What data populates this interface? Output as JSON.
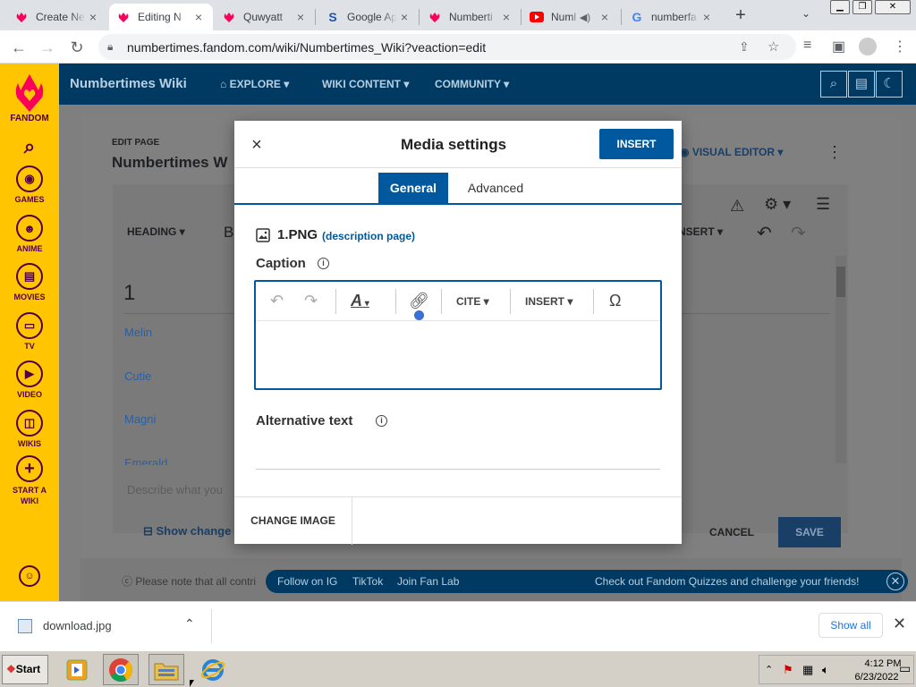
{
  "browser": {
    "tabs": [
      {
        "title": "Create Ne",
        "icon": "fandom-icon"
      },
      {
        "title": "Editing N",
        "icon": "fandom-icon",
        "active": true
      },
      {
        "title": "Quwyatt",
        "icon": "fandom-icon"
      },
      {
        "title": "Google Ap",
        "icon": "s-icon"
      },
      {
        "title": "Numberti",
        "icon": "fandom-icon"
      },
      {
        "title": "Numl",
        "icon": "youtube-icon"
      },
      {
        "title": "numberfa",
        "icon": "google-icon"
      }
    ],
    "close_glyph": "×",
    "new_tab_glyph": "+",
    "url": "numbertimes.fandom.com/wiki/Numbertimes_Wiki?veaction=edit"
  },
  "rail": {
    "logo_label": "FANDOM",
    "items": [
      {
        "label": "GAMES",
        "icon": "gamepad-icon"
      },
      {
        "label": "ANIME",
        "icon": "anime-icon"
      },
      {
        "label": "MOVIES",
        "icon": "movies-icon"
      },
      {
        "label": "TV",
        "icon": "tv-icon"
      },
      {
        "label": "VIDEO",
        "icon": "video-icon"
      },
      {
        "label": "WIKIS",
        "icon": "wikis-icon"
      },
      {
        "label": "START A WIKI",
        "icon": "plus-icon"
      }
    ]
  },
  "header": {
    "wiki_name": "Numbertimes Wiki",
    "nav": [
      "EXPLORE",
      "WIKI CONTENT",
      "COMMUNITY"
    ]
  },
  "page": {
    "edit_label": "EDIT PAGE",
    "title": "Numbertimes W",
    "visual_editor": "VISUAL EDITOR",
    "toolbar_heading": "HEADING",
    "toolbar_b": "B",
    "toolbar_insert": "NSERT",
    "content_first": "1",
    "content_lines": [
      "Melin",
      "Cutie",
      "Magni",
      "Emerald"
    ],
    "summary_placeholder": "Describe what you",
    "show_changes": "Show change",
    "cancel": "CANCEL",
    "save": "SAVE",
    "license_note": "Please note that all contri"
  },
  "modal": {
    "title": "Media settings",
    "insert": "INSERT",
    "close_glyph": "×",
    "tabs": {
      "general": "General",
      "advanced": "Advanced"
    },
    "image_name": "1.PNG",
    "description_link": "(description page)",
    "caption_label": "Caption",
    "caption_toolbar": {
      "undo": "↶",
      "redo": "↷",
      "style": "A",
      "cite": "CITE",
      "insert": "INSERT",
      "special": "Ω"
    },
    "alt_label": "Alternative text",
    "change_image": "CHANGE IMAGE"
  },
  "notice": {
    "links": [
      "Follow on IG",
      "TikTok",
      "Join Fan Lab"
    ],
    "message": "Check out Fandom Quizzes and challenge your friends!"
  },
  "downloads": {
    "file": "download.jpg",
    "show_all": "Show all"
  },
  "taskbar": {
    "start": "Start",
    "time": "4:12 PM",
    "date": "6/23/2022"
  },
  "colors": {
    "fandom_yellow": "#ffc500",
    "wiki_navy": "#003a63",
    "accent_blue": "#00599e"
  }
}
